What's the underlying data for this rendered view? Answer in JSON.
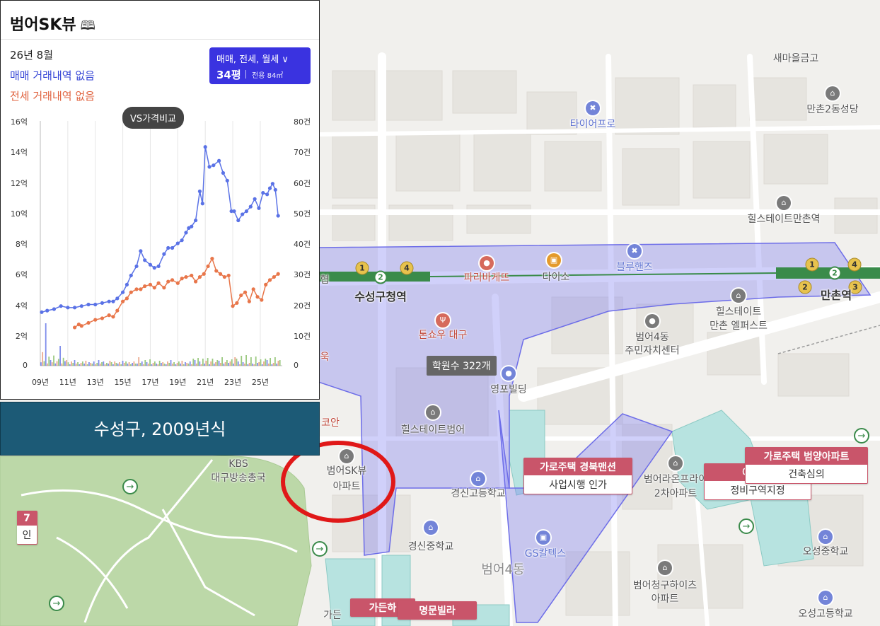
{
  "panel": {
    "title": "범어SK뷰",
    "book_icon": "map-book-icon",
    "date": "26년 8월",
    "sale_status": "매매 거래내역 없음",
    "rent_status": "전세 거래내역 없음",
    "selector": {
      "type_label": "매매, 전세, 월세 ∨",
      "size_label": "34평",
      "area_label": "전용 84㎡"
    },
    "compare_button": "VS가격비교",
    "colors": {
      "sale": "#3545d6",
      "rent": "#e0623e",
      "selector_bg": "#3a33e0"
    }
  },
  "chart_data": {
    "type": "line",
    "x_ticks": [
      "09년",
      "11년",
      "13년",
      "15년",
      "17년",
      "19년",
      "21년",
      "23년",
      "25년"
    ],
    "y_left_ticks": [
      "16억",
      "14억",
      "12억",
      "10억",
      "8억",
      "6억",
      "4억",
      "2억",
      "0"
    ],
    "y_right_ticks": [
      "80건",
      "70건",
      "60건",
      "50건",
      "40건",
      "30건",
      "20건",
      "10건",
      "0"
    ],
    "ylim_left": [
      0,
      16
    ],
    "ylim_right": [
      0,
      80
    ],
    "xlim": [
      2009,
      2026.6
    ],
    "grid": "vertical",
    "series": [
      {
        "color": "#5a72e6",
        "x": [
          2009.1,
          2009.5,
          2010.0,
          2010.5,
          2011.0,
          2011.5,
          2012.0,
          2012.5,
          2013.0,
          2013.5,
          2014.0,
          2014.3,
          2014.6,
          2015.0,
          2015.3,
          2015.6,
          2016.0,
          2016.3,
          2016.6,
          2017.0,
          2017.3,
          2017.6,
          2018.0,
          2018.3,
          2018.6,
          2019.0,
          2019.3,
          2019.6,
          2019.8,
          2020.0,
          2020.3,
          2020.6,
          2020.8,
          2021.0,
          2021.3,
          2021.6,
          2022.0,
          2022.3,
          2022.6,
          2022.9,
          2023.1,
          2023.4,
          2023.7,
          2024.0,
          2024.3,
          2024.6,
          2024.9,
          2025.2,
          2025.5,
          2025.7,
          2025.9,
          2026.1,
          2026.3
        ],
        "values": [
          3.5,
          3.6,
          3.7,
          3.9,
          3.8,
          3.8,
          3.9,
          4.0,
          4.0,
          4.1,
          4.2,
          4.2,
          4.4,
          4.8,
          5.3,
          5.9,
          6.5,
          7.5,
          6.9,
          6.6,
          6.4,
          6.5,
          7.3,
          7.7,
          7.7,
          8.0,
          8.2,
          8.7,
          9.0,
          9.1,
          9.5,
          11.4,
          10.6,
          14.3,
          13.0,
          13.1,
          13.4,
          12.6,
          12.1,
          10.1,
          10.1,
          9.5,
          9.9,
          10.1,
          10.4,
          10.9,
          10.3,
          11.3,
          11.2,
          11.6,
          11.9,
          11.5,
          9.8
        ]
      },
      {
        "color": "#e8764a",
        "x": [
          2011.5,
          2011.8,
          2012.0,
          2012.5,
          2013.0,
          2013.5,
          2014.0,
          2014.3,
          2014.6,
          2015.0,
          2015.3,
          2015.6,
          2016.0,
          2016.3,
          2016.6,
          2017.0,
          2017.3,
          2017.6,
          2018.0,
          2018.3,
          2018.6,
          2019.0,
          2019.3,
          2019.6,
          2020.0,
          2020.3,
          2020.6,
          2020.9,
          2021.2,
          2021.5,
          2021.8,
          2022.1,
          2022.4,
          2022.7,
          2023.0,
          2023.3,
          2023.6,
          2023.9,
          2024.2,
          2024.5,
          2024.8,
          2025.1,
          2025.4,
          2025.7,
          2026.0,
          2026.3
        ],
        "values": [
          2.5,
          2.7,
          2.6,
          2.8,
          3.0,
          3.1,
          3.3,
          3.2,
          3.6,
          4.2,
          4.4,
          4.8,
          5.0,
          5.0,
          5.2,
          5.3,
          5.1,
          5.4,
          5.1,
          5.5,
          5.6,
          5.4,
          5.7,
          5.8,
          5.9,
          5.5,
          5.8,
          6.0,
          6.5,
          7.0,
          6.2,
          6.0,
          5.8,
          5.9,
          3.9,
          4.1,
          4.6,
          4.8,
          4.2,
          5.0,
          4.5,
          4.3,
          5.3,
          5.6,
          5.8,
          6.0
        ]
      }
    ],
    "bar_series": [
      {
        "color": "#6a7ae8"
      },
      {
        "color": "#e89a7a"
      },
      {
        "color": "#8ac06a"
      }
    ]
  },
  "caption": "수성구, 2009년식",
  "map": {
    "labels": [
      {
        "text": "타이어프로",
        "cls": "blue"
      },
      {
        "text": "만촌2동성당",
        "cls": ""
      },
      {
        "text": "힐스테이트만촌역",
        "cls": ""
      },
      {
        "text": "파리바게뜨",
        "cls": "red"
      },
      {
        "text": "다이소",
        "cls": ""
      },
      {
        "text": "블루핸즈",
        "cls": "blue"
      },
      {
        "text": "수성구청역",
        "cls": "bold"
      },
      {
        "text": "만촌역",
        "cls": "bold"
      },
      {
        "text": "톤쇼우 대구",
        "cls": "red"
      },
      {
        "text": "힐스테이트",
        "cls": ""
      },
      {
        "text": "만촌 엘퍼스트",
        "cls": ""
      },
      {
        "text": "범어4동",
        "cls": ""
      },
      {
        "text": "주민자치센터",
        "cls": ""
      },
      {
        "text": "영포빌딩",
        "cls": ""
      },
      {
        "text": "힐스테이트범어",
        "cls": ""
      },
      {
        "text": "KBS",
        "cls": ""
      },
      {
        "text": "대구방송총국",
        "cls": ""
      },
      {
        "text": "범어SK뷰",
        "cls": ""
      },
      {
        "text": "아파트",
        "cls": ""
      },
      {
        "text": "경신고등학교",
        "cls": ""
      },
      {
        "text": "범어라온프라이",
        "cls": ""
      },
      {
        "text": "2차아파트",
        "cls": ""
      },
      {
        "text": "경신중학교",
        "cls": ""
      },
      {
        "text": "GS칼텍스",
        "cls": "blue"
      },
      {
        "text": "범어4동",
        "cls": "big"
      },
      {
        "text": "범어청구하이츠",
        "cls": ""
      },
      {
        "text": "아파트",
        "cls": ""
      },
      {
        "text": "오성중학교",
        "cls": ""
      },
      {
        "text": "오성고등학교",
        "cls": ""
      },
      {
        "text": "새마을금고",
        "cls": ""
      },
      {
        "text": "코안",
        "cls": "red"
      },
      {
        "text": "가든",
        "cls": ""
      },
      {
        "text": "협",
        "cls": ""
      },
      {
        "text": "욱",
        "cls": "red"
      }
    ],
    "academy": "학원수 322개",
    "tags": [
      {
        "top": "가로주택 경북맨션",
        "bottom": "사업시행 인가"
      },
      {
        "top": "가로주택 범양아파트",
        "bottom": "건축심의"
      },
      {
        "top": "예정 수",
        "bottom": "정비구역지정"
      },
      {
        "top": "가든하",
        "bottom": ""
      },
      {
        "top": "명문빌라",
        "bottom": ""
      },
      {
        "top": "7",
        "bottom": "인"
      }
    ],
    "line_badges": [
      "1",
      "2",
      "4",
      "3",
      "1",
      "2",
      "4",
      "2",
      "3"
    ]
  }
}
